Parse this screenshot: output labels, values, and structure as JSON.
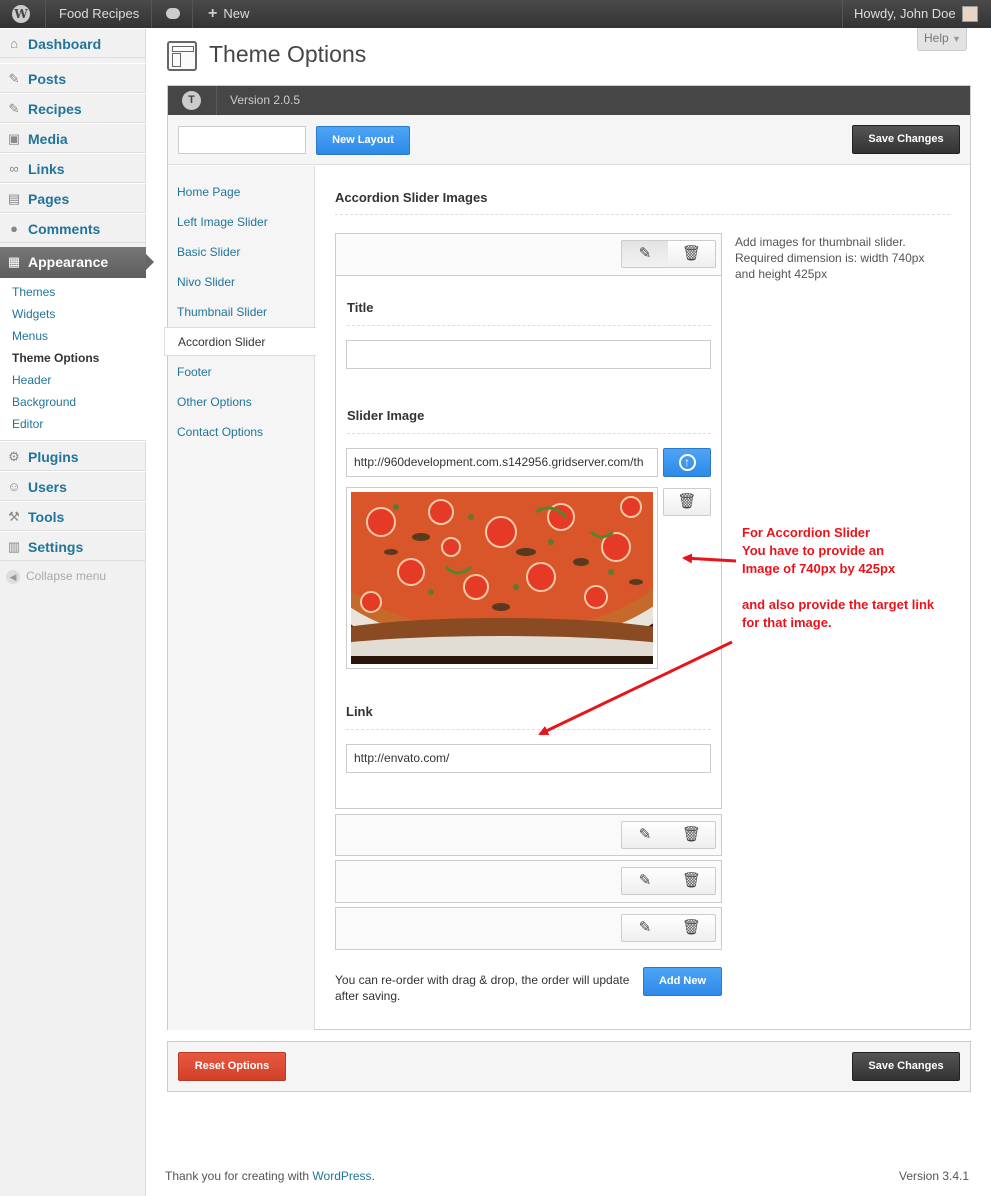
{
  "adminbar": {
    "site_name": "Food Recipes",
    "new_label": "New",
    "howdy": "Howdy, John Doe"
  },
  "sidebar": {
    "items": [
      {
        "label": "Dashboard",
        "icon": "dashboard-icon"
      },
      {
        "label": "Posts",
        "icon": "pin-icon"
      },
      {
        "label": "Recipes",
        "icon": "pin-icon"
      },
      {
        "label": "Media",
        "icon": "media-icon"
      },
      {
        "label": "Links",
        "icon": "link-icon"
      },
      {
        "label": "Pages",
        "icon": "pages-icon"
      },
      {
        "label": "Comments",
        "icon": "comment-icon"
      },
      {
        "label": "Appearance",
        "icon": "appearance-icon"
      },
      {
        "label": "Plugins",
        "icon": "plugin-icon"
      },
      {
        "label": "Users",
        "icon": "users-icon"
      },
      {
        "label": "Tools",
        "icon": "tools-icon"
      },
      {
        "label": "Settings",
        "icon": "settings-icon"
      }
    ],
    "appearance_submenu": [
      "Themes",
      "Widgets",
      "Menus",
      "Theme Options",
      "Header",
      "Background",
      "Editor"
    ],
    "collapse_label": "Collapse menu"
  },
  "page": {
    "title": "Theme Options",
    "help_label": "Help"
  },
  "panel": {
    "version": "Version 2.0.5",
    "new_layout": "New Layout",
    "save_changes": "Save Changes",
    "reset_options": "Reset Options",
    "nav": [
      "Home Page",
      "Left Image Slider",
      "Basic Slider",
      "Nivo Slider",
      "Thumbnail Slider",
      "Accordion Slider",
      "Footer",
      "Other Options",
      "Contact Options"
    ],
    "active_nav": "Accordion Slider"
  },
  "content": {
    "section_title": "Accordion Slider Images",
    "help_text": "Add images for thumbnail slider. Required dimension is: width 740px and height 425px",
    "title_label": "Title",
    "title_value": "",
    "slider_image_label": "Slider Image",
    "slider_image_url": "http://960development.com.s142956.gridserver.com/th",
    "link_label": "Link",
    "link_value": "http://envato.com/",
    "reorder_note": "You can re-order with drag & drop, the order will update after saving.",
    "add_new": "Add New"
  },
  "annotation": {
    "line1": "For Accordion Slider",
    "line2": "You have to provide an",
    "line3": "Image of 740px by 425px",
    "line4": "and also provide the target link",
    "line5": "for that image.",
    "color": "#e8141b"
  },
  "footer": {
    "thanks": "Thank you for creating with",
    "wp_link": "WordPress",
    "period": ".",
    "version": "Version 3.4.1"
  },
  "colors": {
    "accent_blue": "#2d8ae8",
    "link_blue": "#21759b",
    "reset_red": "#d1412a",
    "dark_button": "#333333"
  }
}
